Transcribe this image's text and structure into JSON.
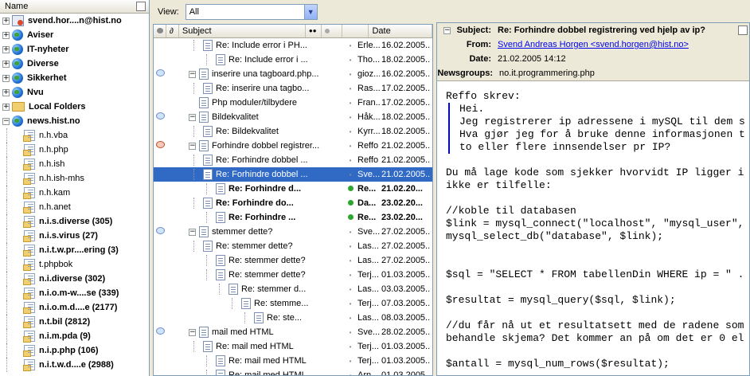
{
  "folders": {
    "header": "Name",
    "items": [
      {
        "label": "svend.hor....n@hist.no",
        "type": "account",
        "bold": true,
        "exp": "+",
        "level": 0
      },
      {
        "label": "Aviser",
        "type": "globe",
        "bold": true,
        "exp": "+",
        "level": 0
      },
      {
        "label": "IT-nyheter",
        "type": "globe",
        "bold": true,
        "exp": "+",
        "level": 0
      },
      {
        "label": "Diverse",
        "type": "globe",
        "bold": true,
        "exp": "+",
        "level": 0
      },
      {
        "label": "Sikkerhet",
        "type": "globe",
        "bold": true,
        "exp": "+",
        "level": 0
      },
      {
        "label": "Nvu",
        "type": "globe",
        "bold": true,
        "exp": "+",
        "level": 0
      },
      {
        "label": "Local Folders",
        "type": "folder",
        "bold": true,
        "exp": "+",
        "level": 0
      },
      {
        "label": "news.hist.no",
        "type": "globe",
        "bold": true,
        "exp": "−",
        "level": 0
      },
      {
        "label": "n.h.vba",
        "type": "ng",
        "bold": false,
        "level": 1
      },
      {
        "label": "n.h.php",
        "type": "ng",
        "bold": false,
        "level": 1
      },
      {
        "label": "n.h.ish",
        "type": "ng",
        "bold": false,
        "level": 1
      },
      {
        "label": "n.h.ish-mhs",
        "type": "ng",
        "bold": false,
        "level": 1
      },
      {
        "label": "n.h.kam",
        "type": "ng",
        "bold": false,
        "level": 1
      },
      {
        "label": "n.h.anet",
        "type": "ng",
        "bold": false,
        "level": 1
      },
      {
        "label": "n.i.s.diverse (305)",
        "type": "ng",
        "bold": true,
        "level": 1
      },
      {
        "label": "n.i.s.virus (27)",
        "type": "ng",
        "bold": true,
        "level": 1
      },
      {
        "label": "n.i.t.w.pr....ering (3)",
        "type": "ng",
        "bold": true,
        "level": 1
      },
      {
        "label": "t.phpbok",
        "type": "ng",
        "bold": false,
        "level": 1
      },
      {
        "label": "n.i.diverse (302)",
        "type": "ng",
        "bold": true,
        "level": 1
      },
      {
        "label": "n.i.o.m-w....se (339)",
        "type": "ng",
        "bold": true,
        "level": 1
      },
      {
        "label": "n.i.o.m.d....e (2177)",
        "type": "ng",
        "bold": true,
        "level": 1
      },
      {
        "label": "n.t.bil (2812)",
        "type": "ng",
        "bold": true,
        "level": 1
      },
      {
        "label": "n.i.m.pda (9)",
        "type": "ng",
        "bold": true,
        "level": 1
      },
      {
        "label": "n.i.p.php (106)",
        "type": "ng",
        "bold": true,
        "level": 1
      },
      {
        "label": "n.i.t.w.d....e (2988)",
        "type": "ng",
        "bold": true,
        "level": 1
      }
    ]
  },
  "view": {
    "label": "View:",
    "value": "All"
  },
  "list": {
    "columns": {
      "subject": "Subject",
      "from": "",
      "date": "Date"
    },
    "rows": [
      {
        "subject": "Re: Include error i PH...",
        "from": "Erle...",
        "date": "16.02.2005...",
        "depth": 1,
        "bubble": "",
        "exp": "",
        "state": ""
      },
      {
        "subject": "Re: Include error i ...",
        "from": "Tho...",
        "date": "18.02.2005...",
        "depth": 2,
        "bubble": "",
        "exp": "",
        "state": ""
      },
      {
        "subject": "inserire una tagboard.php...",
        "from": "gioz...",
        "date": "16.02.2005...",
        "depth": 0,
        "bubble": "blue",
        "exp": "−",
        "state": ""
      },
      {
        "subject": "Re: inserire una tagbo...",
        "from": "Ras...",
        "date": "17.02.2005...",
        "depth": 1,
        "bubble": "",
        "exp": "",
        "state": ""
      },
      {
        "subject": "Php moduler/tilbydere",
        "from": "Fran...",
        "date": "17.02.2005...",
        "depth": 0,
        "bubble": "",
        "exp": "",
        "state": ""
      },
      {
        "subject": "Bildekvalitet",
        "from": "Håk...",
        "date": "18.02.2005...",
        "depth": 0,
        "bubble": "blue",
        "exp": "−",
        "state": ""
      },
      {
        "subject": "Re: Bildekvalitet",
        "from": "Kyrr...",
        "date": "18.02.2005...",
        "depth": 1,
        "bubble": "",
        "exp": "",
        "state": ""
      },
      {
        "subject": "Forhindre dobbel registrer...",
        "from": "Reffo",
        "date": "21.02.2005...",
        "depth": 0,
        "bubble": "red",
        "exp": "−",
        "state": ""
      },
      {
        "subject": "Re: Forhindre dobbel ...",
        "from": "Reffo",
        "date": "21.02.2005...",
        "depth": 1,
        "bubble": "",
        "exp": "",
        "state": ""
      },
      {
        "subject": "Re: Forhindre dobbel ...",
        "from": "Sve...",
        "date": "21.02.2005...",
        "depth": 1,
        "bubble": "",
        "exp": "",
        "state": "sel"
      },
      {
        "subject": "Re: Forhindre d...",
        "from": "Re...",
        "date": "21.02.20...",
        "depth": 2,
        "bubble": "",
        "exp": "",
        "state": "bold"
      },
      {
        "subject": "Re: Forhindre do...",
        "from": "Da...",
        "date": "23.02.20...",
        "depth": 1,
        "bubble": "",
        "exp": "",
        "state": "bold"
      },
      {
        "subject": "Re: Forhindre ...",
        "from": "Re...",
        "date": "23.02.20...",
        "depth": 2,
        "bubble": "",
        "exp": "",
        "state": "bold"
      },
      {
        "subject": "stemmer dette?",
        "from": "Sve...",
        "date": "27.02.2005...",
        "depth": 0,
        "bubble": "blue",
        "exp": "−",
        "state": ""
      },
      {
        "subject": "Re: stemmer dette?",
        "from": "Las...",
        "date": "27.02.2005...",
        "depth": 1,
        "bubble": "",
        "exp": "",
        "state": ""
      },
      {
        "subject": "Re: stemmer dette?",
        "from": "Las...",
        "date": "27.02.2005...",
        "depth": 2,
        "bubble": "",
        "exp": "",
        "state": ""
      },
      {
        "subject": "Re: stemmer dette?",
        "from": "Terj...",
        "date": "01.03.2005...",
        "depth": 2,
        "bubble": "",
        "exp": "",
        "state": ""
      },
      {
        "subject": "Re: stemmer d...",
        "from": "Las...",
        "date": "03.03.2005...",
        "depth": 3,
        "bubble": "",
        "exp": "",
        "state": ""
      },
      {
        "subject": "Re: stemme...",
        "from": "Terj...",
        "date": "07.03.2005...",
        "depth": 4,
        "bubble": "",
        "exp": "",
        "state": ""
      },
      {
        "subject": "Re: ste...",
        "from": "Las...",
        "date": "08.03.2005...",
        "depth": 5,
        "bubble": "",
        "exp": "",
        "state": ""
      },
      {
        "subject": "mail med HTML",
        "from": "Sve...",
        "date": "28.02.2005...",
        "depth": 0,
        "bubble": "blue",
        "exp": "−",
        "state": ""
      },
      {
        "subject": "Re: mail med HTML",
        "from": "Terj...",
        "date": "01.03.2005...",
        "depth": 1,
        "bubble": "",
        "exp": "",
        "state": ""
      },
      {
        "subject": "Re: mail med HTML",
        "from": "Terj...",
        "date": "01.03.2005...",
        "depth": 2,
        "bubble": "",
        "exp": "",
        "state": ""
      },
      {
        "subject": "Re: mail med HTML",
        "from": "Arn...",
        "date": "01.03.2005...",
        "depth": 2,
        "bubble": "",
        "exp": "",
        "state": ""
      }
    ]
  },
  "preview": {
    "subject_label": "Subject:",
    "subject": "Re: Forhindre dobbel registrering ved hjelp av ip?",
    "from_label": "From:",
    "from": "Svend Andreas Horgen <svend.horgen@hist.no>",
    "date_label": "Date:",
    "date": "21.02.2005 14:12",
    "newsgroups_label": "Newsgroups:",
    "newsgroups": "no.it.programmering.php",
    "intro": "Reffo skrev:",
    "quote": "Hei.\nJeg registrerer ip adressene i mySQL til dem s\nHva gjør jeg for å bruke denne informasjonen t\nto eller flere innsendelser pr IP?",
    "body": "Du må lage kode som sjekker hvorvidt IP ligger i\nikke er tilfelle:\n\n//koble til databasen\n$link = mysql_connect(\"localhost\", \"mysql_user\",\nmysql_select_db(\"database\", $link);\n\n\n$sql = \"SELECT * FROM tabellenDin WHERE ip = \" .\n\n$resultat = mysql_query($sql, $link);\n\n//du får nå ut et resultatsett med de radene som\nbehandle skjema? Det kommer an på om det er 0 el\n\n$antall = mysql_num_rows($resultat);"
  }
}
